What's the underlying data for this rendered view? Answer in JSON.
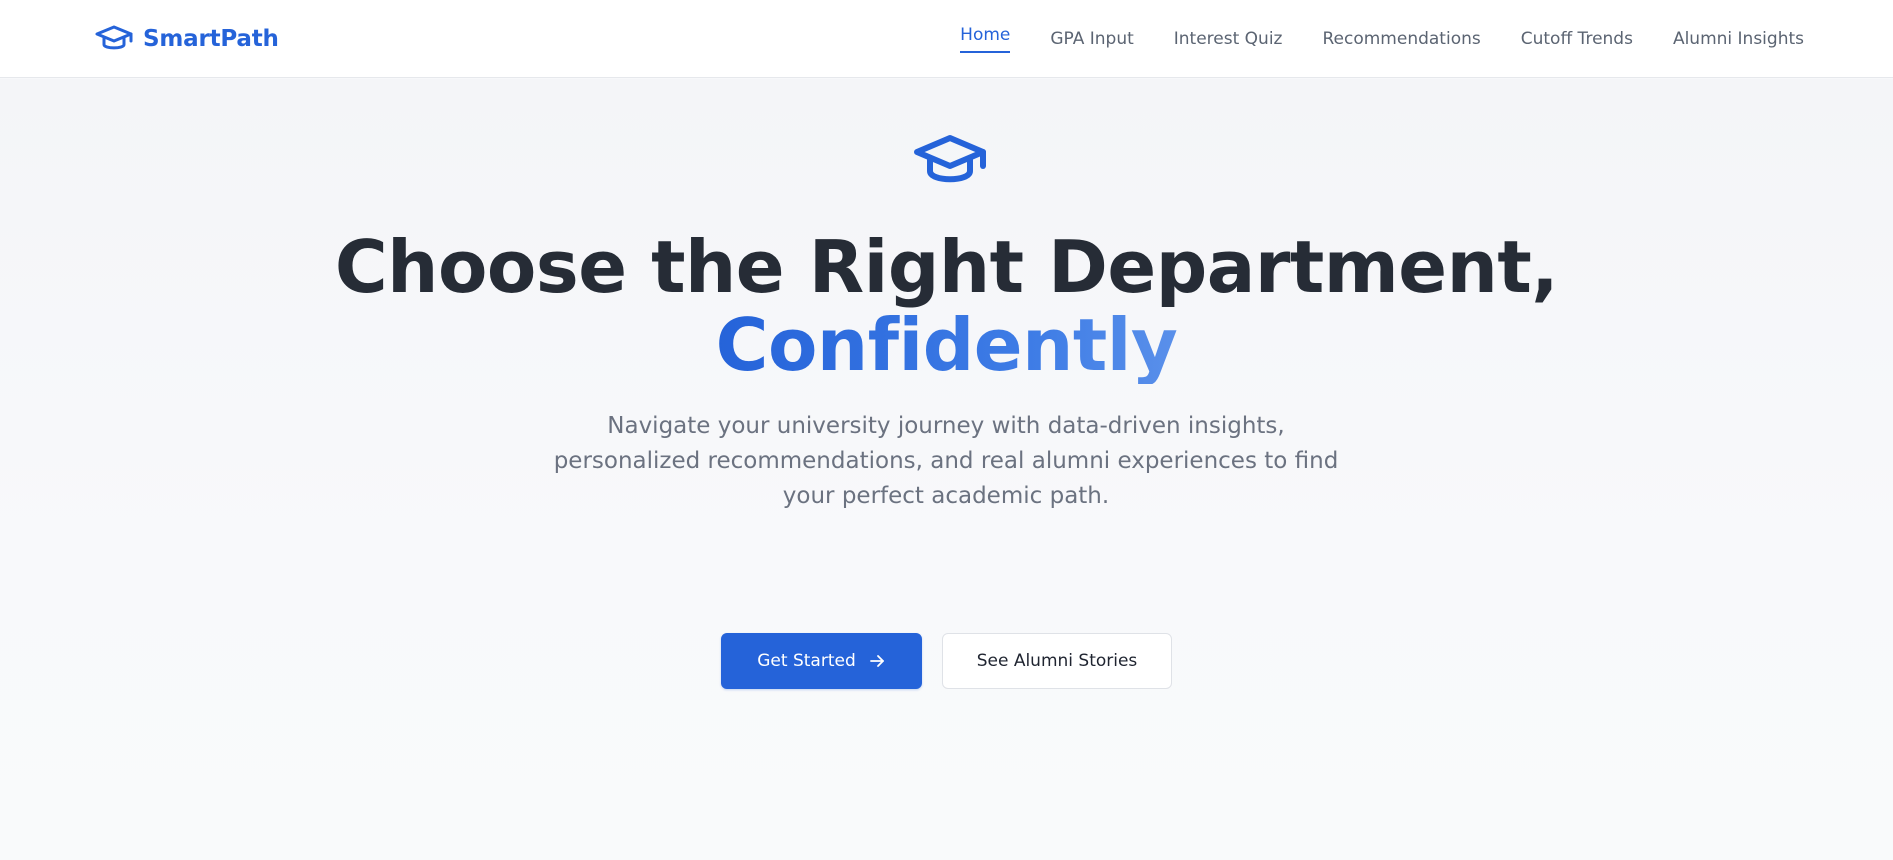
{
  "brand": {
    "name": "SmartPath",
    "icon": "graduation-cap-icon",
    "color": "#2563d9"
  },
  "nav": {
    "items": [
      {
        "label": "Home",
        "active": true
      },
      {
        "label": "GPA Input",
        "active": false
      },
      {
        "label": "Interest Quiz",
        "active": false
      },
      {
        "label": "Recommendations",
        "active": false
      },
      {
        "label": "Cutoff Trends",
        "active": false
      },
      {
        "label": "Alumni Insights",
        "active": false
      }
    ]
  },
  "hero": {
    "icon": "graduation-cap-icon",
    "headline_line1": "Choose the Right Department,",
    "headline_line2": "Confidently",
    "subtitle": "Navigate your university journey with data-driven insights, personalized recommendations, and real alumni experiences to find your perfect academic path.",
    "primary_button": {
      "label": "Get Started",
      "icon": "arrow-right-icon"
    },
    "secondary_button": {
      "label": "See Alumni Stories"
    }
  },
  "colors": {
    "accent": "#2563d9",
    "heading": "#262c36",
    "muted_text": "#6b7280",
    "nav_text": "#5b6472"
  }
}
